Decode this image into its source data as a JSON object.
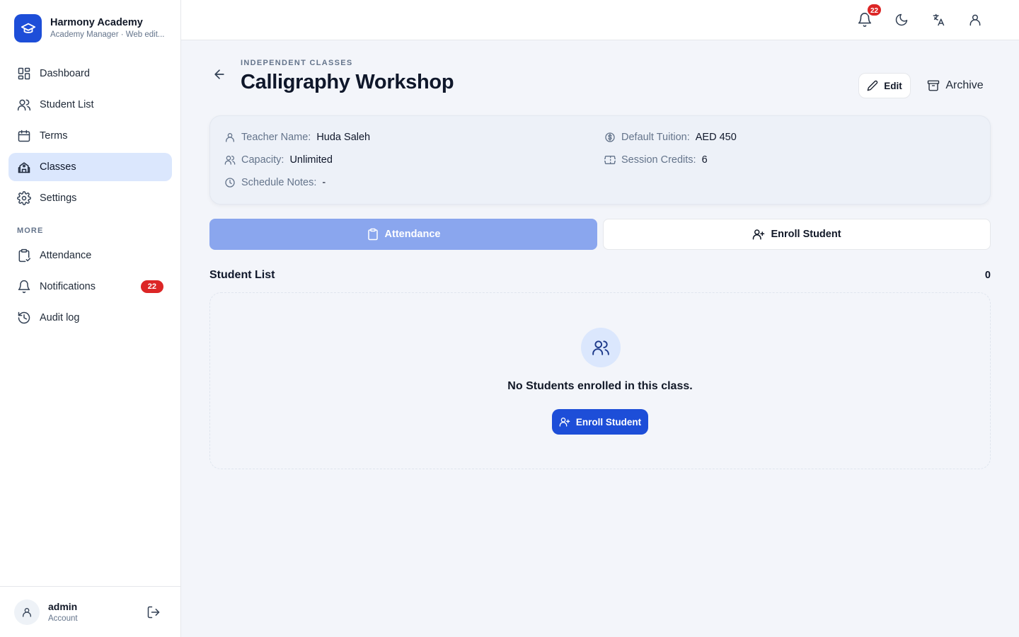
{
  "brand": {
    "name": "Harmony Academy",
    "subtitle": "Academy Manager · Web edit..."
  },
  "sidebar": {
    "items": [
      {
        "label": "Dashboard",
        "icon": "dashboard-icon",
        "active": false
      },
      {
        "label": "Student List",
        "icon": "users-icon",
        "active": false
      },
      {
        "label": "Terms",
        "icon": "calendar-icon",
        "active": false
      },
      {
        "label": "Classes",
        "icon": "school-icon",
        "active": true
      },
      {
        "label": "Settings",
        "icon": "gear-icon",
        "active": false
      }
    ],
    "section_label": "MORE",
    "more_items": [
      {
        "label": "Attendance",
        "icon": "clipboard-icon"
      },
      {
        "label": "Notifications",
        "icon": "bell-icon",
        "badge": "22"
      },
      {
        "label": "Audit log",
        "icon": "history-icon"
      }
    ]
  },
  "account": {
    "name": "admin",
    "role": "Account"
  },
  "topbar": {
    "notification_count": "22"
  },
  "header": {
    "eyebrow": "INDEPENDENT CLASSES",
    "title": "Calligraphy Workshop",
    "edit_label": "Edit",
    "archive_label": "Archive"
  },
  "info": {
    "teacher": {
      "label": "Teacher Name:",
      "value": "Huda Saleh"
    },
    "capacity": {
      "label": "Capacity:",
      "value": "Unlimited"
    },
    "schedule": {
      "label": "Schedule Notes:",
      "value": "-"
    },
    "tuition": {
      "label": "Default Tuition:",
      "value": "AED 450"
    },
    "credits": {
      "label": "Session Credits:",
      "value": "6"
    }
  },
  "actions": {
    "attendance_label": "Attendance",
    "enroll_label": "Enroll Student"
  },
  "students": {
    "title": "Student List",
    "count": "0",
    "empty_text": "No Students enrolled in this class.",
    "empty_button": "Enroll Student"
  },
  "colors": {
    "primary": "#1d4ed8",
    "active_nav": "#dbe7fd",
    "badge": "#dc2626",
    "attendance_button": "#8aa6ee"
  }
}
